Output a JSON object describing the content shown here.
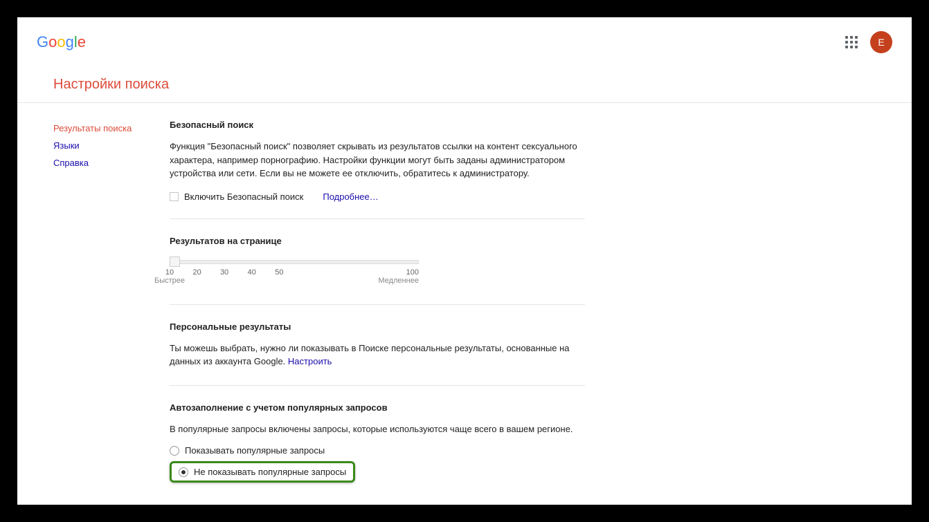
{
  "header": {
    "logo_letters": [
      "G",
      "o",
      "o",
      "g",
      "l",
      "e"
    ],
    "avatar_letter": "E"
  },
  "page_title": "Настройки поиска",
  "sidebar": {
    "items": [
      {
        "label": "Результаты поиска",
        "active": true
      },
      {
        "label": "Языки",
        "active": false
      },
      {
        "label": "Справка",
        "active": false
      }
    ]
  },
  "safesearch": {
    "title": "Безопасный поиск",
    "desc": "Функция \"Безопасный поиск\" позволяет скрывать из результатов ссылки на контент сексуального характера, например порнографию. Настройки функции могут быть заданы администратором устройства или сети. Если вы не можете ее отключить, обратитесь к администратору.",
    "checkbox_label": "Включить Безопасный поиск",
    "learn_more": "Подробнее…"
  },
  "results_per_page": {
    "title": "Результатов на странице",
    "ticks": [
      "10",
      "20",
      "30",
      "40",
      "50",
      "100"
    ],
    "label_fast": "Быстрее",
    "label_slow": "Медленнее"
  },
  "personal": {
    "title": "Персональные результаты",
    "desc_prefix": "Ты можешь выбрать, нужно ли показывать в Поиске персональные результаты, основанные на данных из аккаунта Google. ",
    "configure": "Настроить"
  },
  "autocomplete": {
    "title": "Автозаполнение с учетом популярных запросов",
    "desc": "В популярные запросы включены запросы, которые используются чаще всего в вашем регионе.",
    "option_show": "Показывать популярные запросы",
    "option_hide": "Не показывать популярные запросы"
  }
}
